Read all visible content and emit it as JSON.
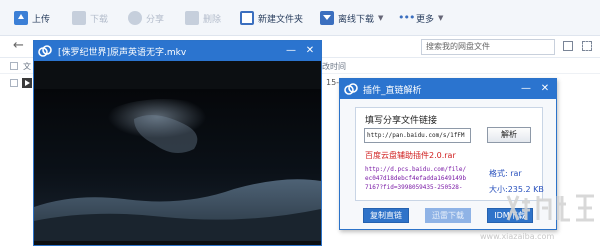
{
  "toolbar": {
    "upload": "上传",
    "download": "下载",
    "share": "分享",
    "delete": "删除",
    "new_folder": "新建文件夹",
    "offline_download": "离线下载",
    "more": "更多"
  },
  "nav": {
    "search_placeholder": "搜索我的网盘文件"
  },
  "file_list": {
    "col_name_partial": "文",
    "col_time_partial": "改时间",
    "row_date_partial": "15-"
  },
  "video_window": {
    "title": "[侏罗纪世界]原声英语无字.mkv"
  },
  "plugin_window": {
    "title": "插件_直链解析",
    "label": "填写分享文件链接",
    "url_value": "http://pan.baidu.com/s/1fFM",
    "parse_button": "解析",
    "plugin_name": "百度云盘辅助插件2.0.rar",
    "direct_link": [
      "http://d.pcs.baidu.com/file/",
      "ec047d18debcf4efadda1649149b",
      "7167?fid=3998059435-250528-"
    ],
    "format_label": "格式: rar",
    "size_label": "大小:235.2 KB",
    "copy_button": "复制直链",
    "thunder_button": "迅雷下载",
    "idm_button": "IDM下载"
  },
  "watermark": {
    "url": "www.xiazaiba.com"
  },
  "colors": {
    "accent_blue": "#2b74cf",
    "red_text": "#d02020",
    "purple_link": "#7a1aa6"
  }
}
